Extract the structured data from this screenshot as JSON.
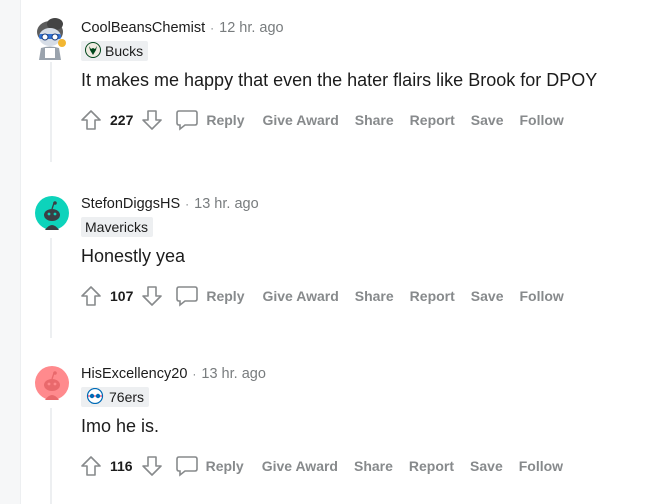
{
  "comments": [
    {
      "username": "CoolBeansChemist",
      "separator": "·",
      "time": "12 hr. ago",
      "flair": "Bucks",
      "flair_icon": "bucks-logo-icon",
      "text": "It makes me happy that even the hater flairs like Brook for DPOY",
      "score": "227",
      "avatar_icon": "snoo-avatar-custom-icon"
    },
    {
      "username": "StefonDiggsHS",
      "separator": "·",
      "time": "13 hr. ago",
      "flair": "Mavericks",
      "flair_icon": "",
      "text": "Honestly yea",
      "score": "107",
      "avatar_icon": "snoo-avatar-cyan-icon",
      "avatar_color": "#0dd3bb"
    },
    {
      "username": "HisExcellency20",
      "separator": "·",
      "time": "13 hr. ago",
      "flair": "76ers",
      "flair_icon": "sixers-logo-icon",
      "text": "Imo he is.",
      "score": "116",
      "avatar_icon": "snoo-avatar-pink-icon",
      "avatar_color": "#ff585b"
    }
  ],
  "actions": {
    "reply": "Reply",
    "give_award": "Give Award",
    "share": "Share",
    "report": "Report",
    "save": "Save",
    "follow": "Follow"
  }
}
